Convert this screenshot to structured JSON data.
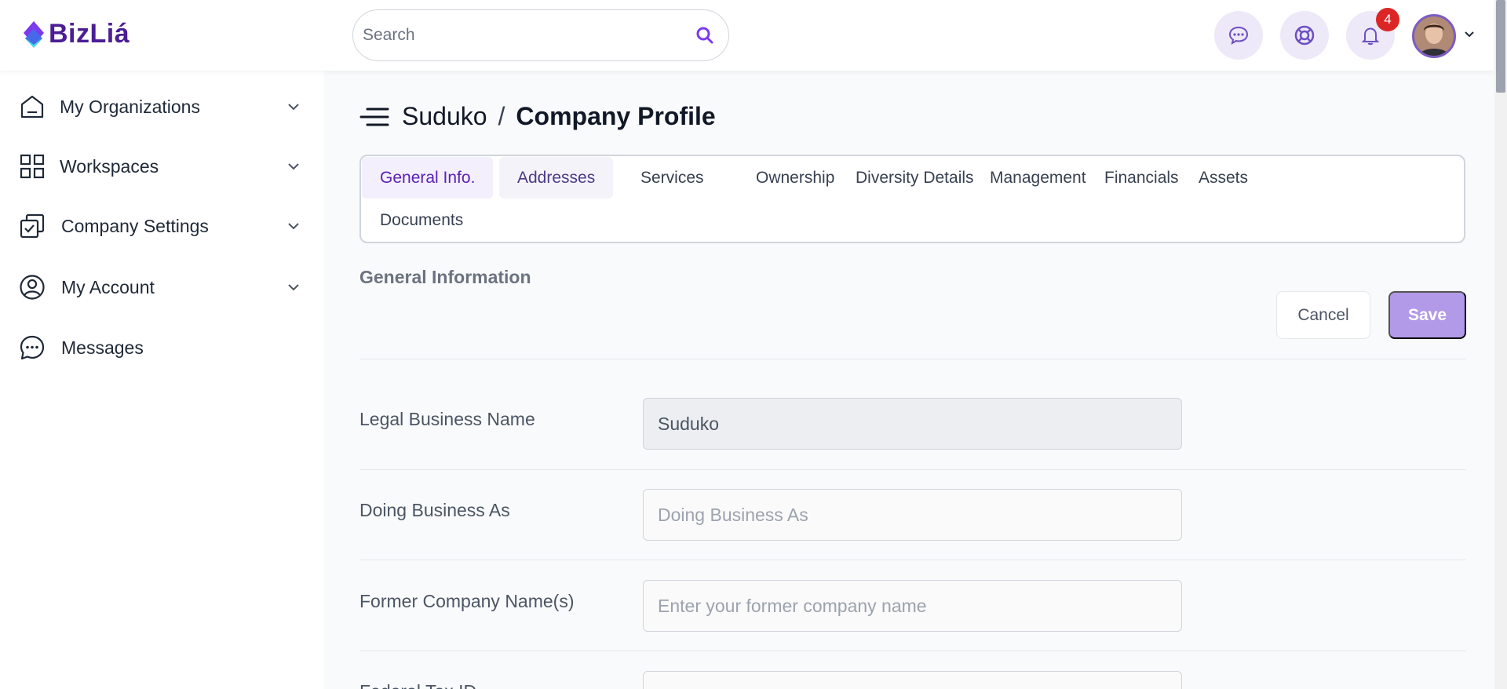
{
  "brand": {
    "name": "BizLiá",
    "accent": "#5b21b6"
  },
  "header": {
    "search_placeholder": "Search",
    "notification_count": "4",
    "icons": [
      "chat-icon",
      "support-icon",
      "bell-icon"
    ]
  },
  "sidebar": {
    "items": [
      {
        "label": "My Organizations",
        "icon": "home-icon"
      },
      {
        "label": "Workspaces",
        "icon": "grid-icon"
      },
      {
        "label": "Company Settings",
        "icon": "settings-check-icon"
      },
      {
        "label": "My Account",
        "icon": "user-circle-icon"
      },
      {
        "label": "Messages",
        "icon": "message-icon"
      }
    ]
  },
  "page": {
    "org": "Suduko",
    "separator": "/",
    "title": "Company Profile"
  },
  "tabs": [
    {
      "label": "General Info."
    },
    {
      "label": "Addresses"
    },
    {
      "label": "Services"
    },
    {
      "label": "Ownership"
    },
    {
      "label": "Diversity Details"
    },
    {
      "label": "Management"
    },
    {
      "label": "Financials"
    },
    {
      "label": "Assets"
    },
    {
      "label": "Documents"
    }
  ],
  "section": {
    "title": "General Information",
    "cancel_label": "Cancel",
    "save_label": "Save"
  },
  "fields": [
    {
      "label": "Legal Business Name",
      "value": "Suduko",
      "placeholder": ""
    },
    {
      "label": "Doing Business As",
      "value": "",
      "placeholder": "Doing Business As"
    },
    {
      "label": "Former Company Name(s)",
      "value": "",
      "placeholder": "Enter your former company name"
    },
    {
      "label": "Federal Tax ID",
      "value": "",
      "placeholder": ""
    }
  ]
}
